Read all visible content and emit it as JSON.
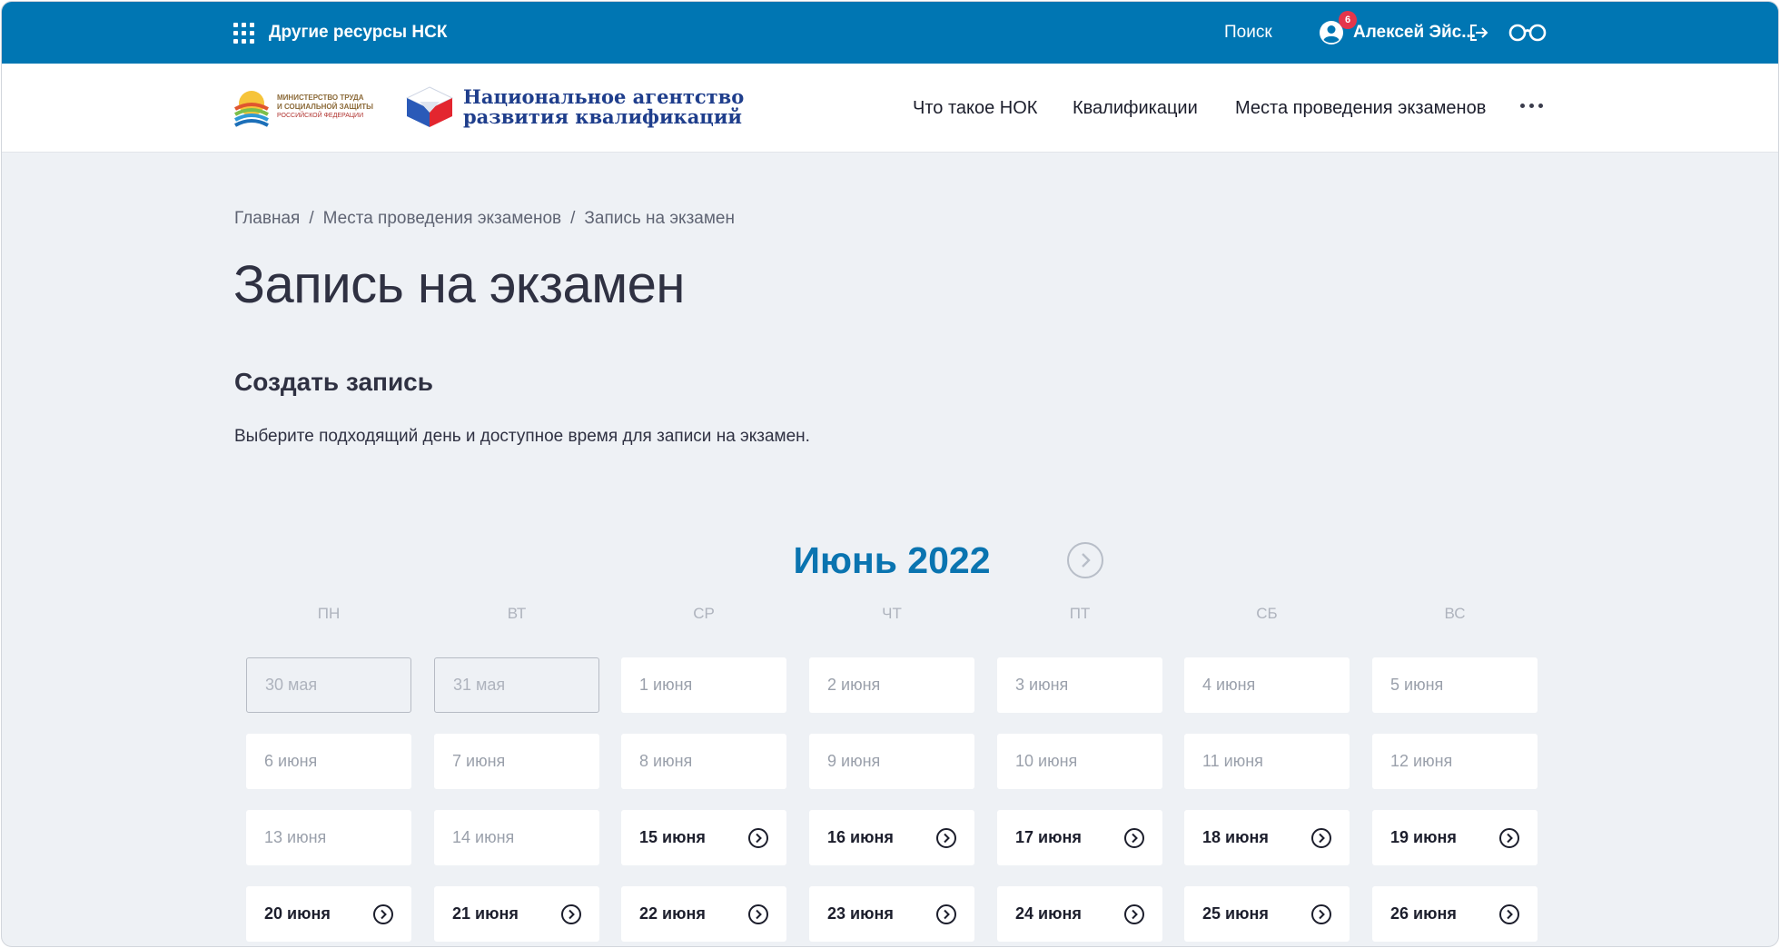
{
  "topbar": {
    "resources_label": "Другие ресурсы НСК",
    "search_label": "Поиск",
    "user_name": "Алексей Эйс...",
    "notification_count": "6"
  },
  "header": {
    "ministry_logo_text": [
      "Министерство труда",
      "и социальной защиты",
      "Российской Федерации"
    ],
    "agency_name_line1": "Национальное агентство",
    "agency_name_line2": "развития квалификаций",
    "nav": [
      "Что такое НОК",
      "Квалификации",
      "Места проведения экзаменов"
    ]
  },
  "breadcrumb": [
    "Главная",
    "Места проведения экзаменов",
    "Запись на экзамен"
  ],
  "page_title": "Запись на экзамен",
  "section_title": "Создать запись",
  "description": "Выберите подходящий день и доступное время для записи на экзамен.",
  "calendar": {
    "month_label": "Июнь 2022",
    "weekdays": [
      "ПН",
      "ВТ",
      "СР",
      "ЧТ",
      "ПТ",
      "СБ",
      "ВС"
    ],
    "days": [
      {
        "label": "30 мая",
        "state": "past"
      },
      {
        "label": "31 мая",
        "state": "past"
      },
      {
        "label": "1 июня",
        "state": "unavailable"
      },
      {
        "label": "2 июня",
        "state": "unavailable"
      },
      {
        "label": "3 июня",
        "state": "unavailable"
      },
      {
        "label": "4 июня",
        "state": "unavailable"
      },
      {
        "label": "5 июня",
        "state": "unavailable"
      },
      {
        "label": "6 июня",
        "state": "unavailable"
      },
      {
        "label": "7 июня",
        "state": "unavailable"
      },
      {
        "label": "8 июня",
        "state": "unavailable"
      },
      {
        "label": "9 июня",
        "state": "unavailable"
      },
      {
        "label": "10 июня",
        "state": "unavailable"
      },
      {
        "label": "11 июня",
        "state": "unavailable"
      },
      {
        "label": "12 июня",
        "state": "unavailable"
      },
      {
        "label": "13 июня",
        "state": "unavailable"
      },
      {
        "label": "14 июня",
        "state": "unavailable"
      },
      {
        "label": "15 июня",
        "state": "available"
      },
      {
        "label": "16 июня",
        "state": "available"
      },
      {
        "label": "17 июня",
        "state": "available"
      },
      {
        "label": "18 июня",
        "state": "available"
      },
      {
        "label": "19 июня",
        "state": "available"
      },
      {
        "label": "20 июня",
        "state": "available"
      },
      {
        "label": "21 июня",
        "state": "available"
      },
      {
        "label": "22 июня",
        "state": "available"
      },
      {
        "label": "23 июня",
        "state": "available"
      },
      {
        "label": "24 июня",
        "state": "available"
      },
      {
        "label": "25 июня",
        "state": "available"
      },
      {
        "label": "26 июня",
        "state": "available"
      }
    ]
  },
  "colors": {
    "topbar": "#0076b3",
    "accent": "#0a74b0",
    "background": "#eef1f5",
    "badge": "#e4364b"
  }
}
